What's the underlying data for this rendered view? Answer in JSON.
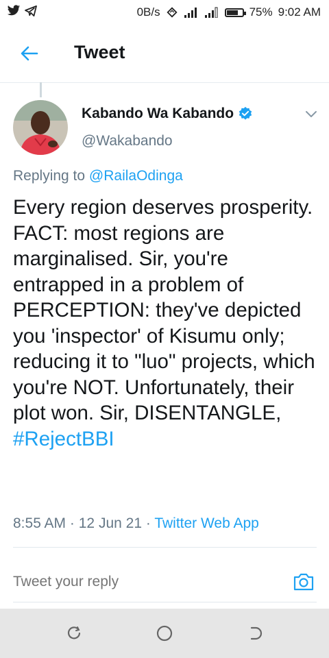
{
  "status_bar": {
    "net_speed": "0B/s",
    "battery_percent": "75%",
    "battery_level": 0.75,
    "time": "9:02 AM",
    "icons": [
      "twitter-icon",
      "telegram-icon",
      "sync-icon",
      "signal-icon",
      "signal-icon",
      "battery-icon"
    ]
  },
  "header": {
    "title": "Tweet",
    "back_icon": "arrow-left-icon"
  },
  "tweet": {
    "author_name": "Kabando Wa Kabando",
    "author_handle": "@Wakabando",
    "verified": true,
    "replying_prefix": "Replying to",
    "replying_to": "@RailaOdinga",
    "text": "Every region deserves prosperity.  FACT: most regions are marginalised. Sir, you're entrapped in a problem of PERCEPTION: they've depicted you 'inspector' of Kisumu only; reducing it to \"luo\" projects, which you're NOT. Unfortunately, their plot won. Sir, DISENTANGLE,",
    "hashtag": "#RejectBBI",
    "time": "8:55 AM",
    "separator": "·",
    "date": "12 Jun 21",
    "source": "Twitter Web App"
  },
  "reply": {
    "placeholder": "Tweet your reply",
    "camera_icon": "camera-icon"
  },
  "colors": {
    "accent": "#1da1f2",
    "secondary_text": "#657786",
    "primary_text": "#14171a",
    "navbar_bg": "#e6e6e6"
  }
}
